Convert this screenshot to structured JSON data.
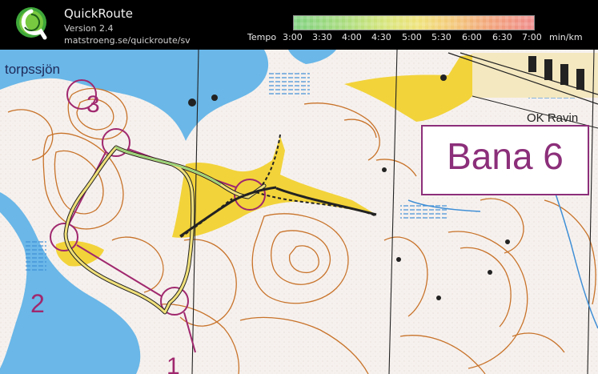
{
  "app": {
    "name": "QuickRoute",
    "version": "Version 2.4",
    "url": "matstroeng.se/quickroute/sv"
  },
  "legend": {
    "label": "Tempo",
    "ticks": [
      "3:00",
      "3:30",
      "4:00",
      "4:30",
      "5:00",
      "5:30",
      "6:00",
      "6:30",
      "7:00"
    ],
    "unit": "min/km"
  },
  "map": {
    "lake_name": "torpssjön",
    "club_name": "OK Ravin",
    "course_title": "Bana 6",
    "control_numbers": [
      "1",
      "2",
      "3"
    ],
    "colors": {
      "course": "#a0286e",
      "water": "#6ab7e8",
      "open_land": "#f2d33a",
      "contours": "#c8732a",
      "route_slow": "#f0e07a",
      "route_fast": "#7fd17f"
    }
  }
}
